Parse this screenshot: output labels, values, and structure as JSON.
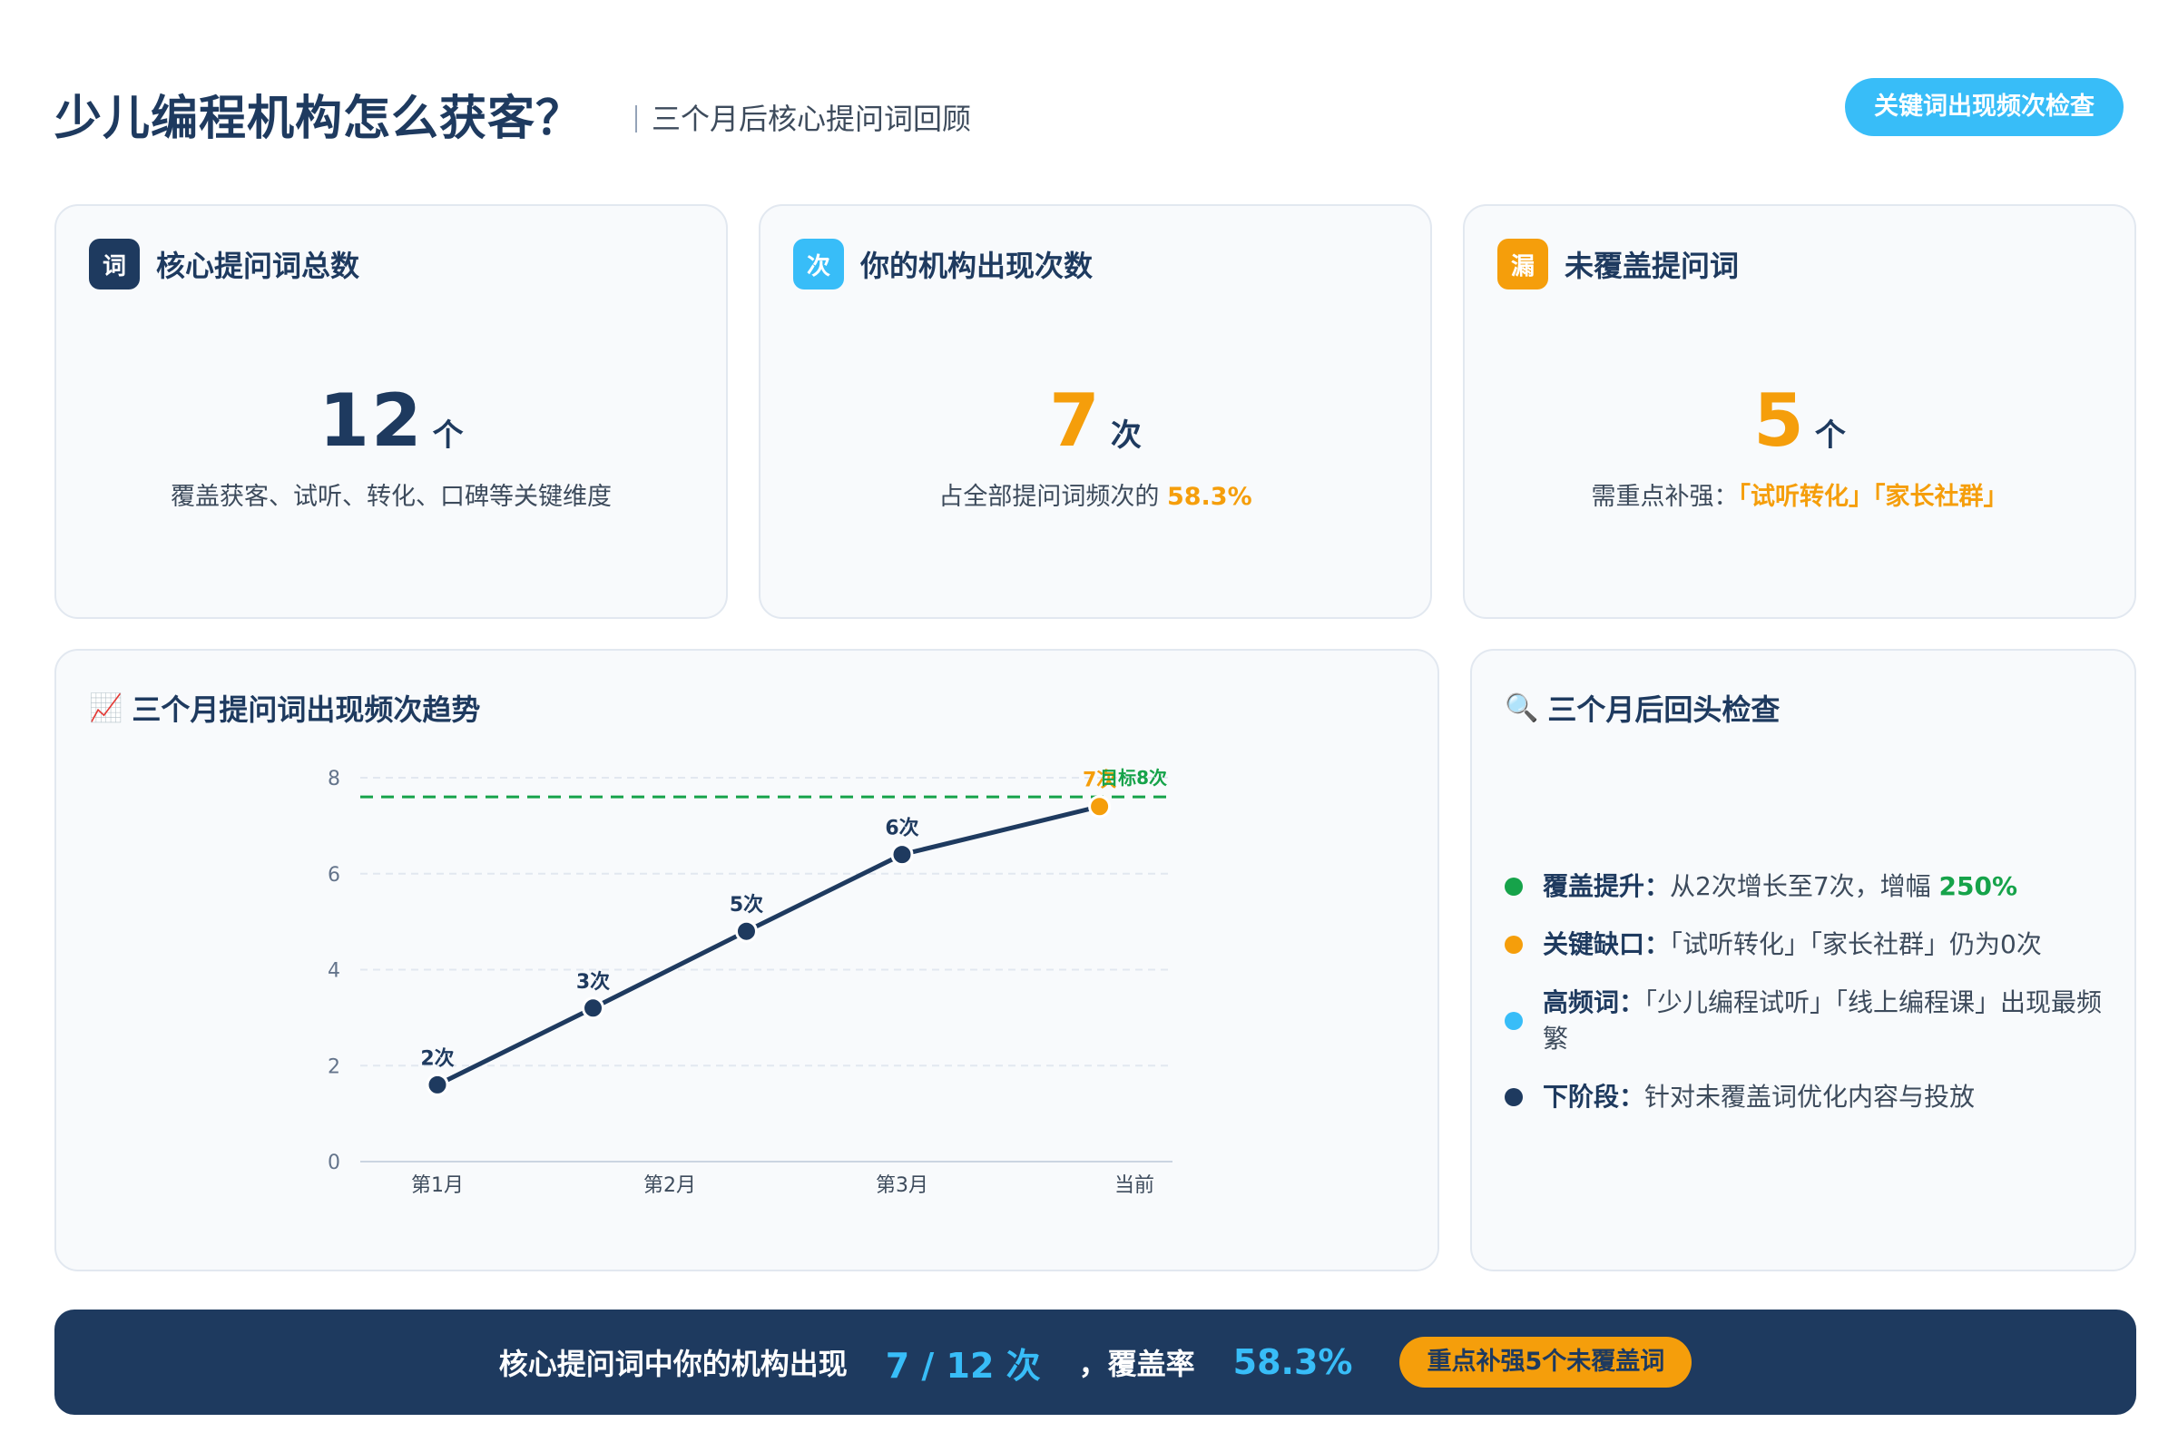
{
  "header": {
    "title": "少儿编程机构怎么获客？",
    "subtitle": "三个月后核心提问词回顾",
    "check_button": "关键词出现频次检查"
  },
  "stats": [
    {
      "badge": "词",
      "badge_color": "#1e3a5f",
      "title": "核心提问词总数",
      "value": "12",
      "value_color": "#1e3a5f",
      "unit": "个",
      "desc": "覆盖获客、试听、转化、口碑等关键维度",
      "desc_highlight": ""
    },
    {
      "badge": "次",
      "badge_color": "#38bdf8",
      "title": "你的机构出现次数",
      "value": "7",
      "value_color": "#f59e0b",
      "unit": "次",
      "desc": "占全部提问词频次的 ",
      "desc_highlight": "58.3%"
    },
    {
      "badge": "漏",
      "badge_color": "#f59e0b",
      "title": "未覆盖提问词",
      "value": "5",
      "value_color": "#f59e0b",
      "unit": "个",
      "desc": "需重点补强：",
      "desc_highlight": "「试听转化」「家长社群」"
    }
  ],
  "chart_panel": {
    "icon": "📈",
    "title": "三个月提问词出现频次趋势"
  },
  "chart_data": {
    "type": "line",
    "categories": [
      "第1月",
      "第2月",
      "第3月",
      "当前"
    ],
    "x": [
      0,
      0.67,
      1.33,
      2,
      2.67,
      3
    ],
    "values": [
      1.6,
      3.2,
      4.8,
      6.4,
      7.4
    ],
    "x_positions": [
      0,
      0.67,
      1.33,
      2,
      2.85
    ],
    "point_labels": [
      "2次",
      "3次",
      "5次",
      "6次",
      "7次"
    ],
    "ylim": [
      0,
      8
    ],
    "yticks": [
      0,
      2,
      4,
      6,
      8
    ],
    "target": {
      "value": 7.6,
      "label": "目标8次"
    },
    "colors": {
      "line": "#1e3a5f",
      "last_point": "#f59e0b",
      "target": "#16a34a"
    },
    "grid": true
  },
  "check_panel": {
    "icon": "🔍",
    "title": "三个月后回头检查",
    "items": [
      {
        "color": "#16a34a",
        "label": "覆盖提升：",
        "text": "从2次增长至7次，增幅 ",
        "highlight": "250%"
      },
      {
        "color": "#f59e0b",
        "label": "关键缺口：",
        "text": "「试听转化」「家长社群」仍为0次",
        "highlight": ""
      },
      {
        "color": "#38bdf8",
        "label": "高频词：",
        "text": "「少儿编程试听」「线上编程课」出现最频繁",
        "highlight": ""
      },
      {
        "color": "#1e3a5f",
        "label": "下阶段：",
        "text": "针对未覆盖词优化内容与投放",
        "highlight": ""
      }
    ]
  },
  "summary": {
    "text": "核心提问词中你的机构出现",
    "count": "7 / 12 次",
    "rate_label": "，覆盖率",
    "rate": "58.3%",
    "badge": "重点补强5个未覆盖词"
  }
}
